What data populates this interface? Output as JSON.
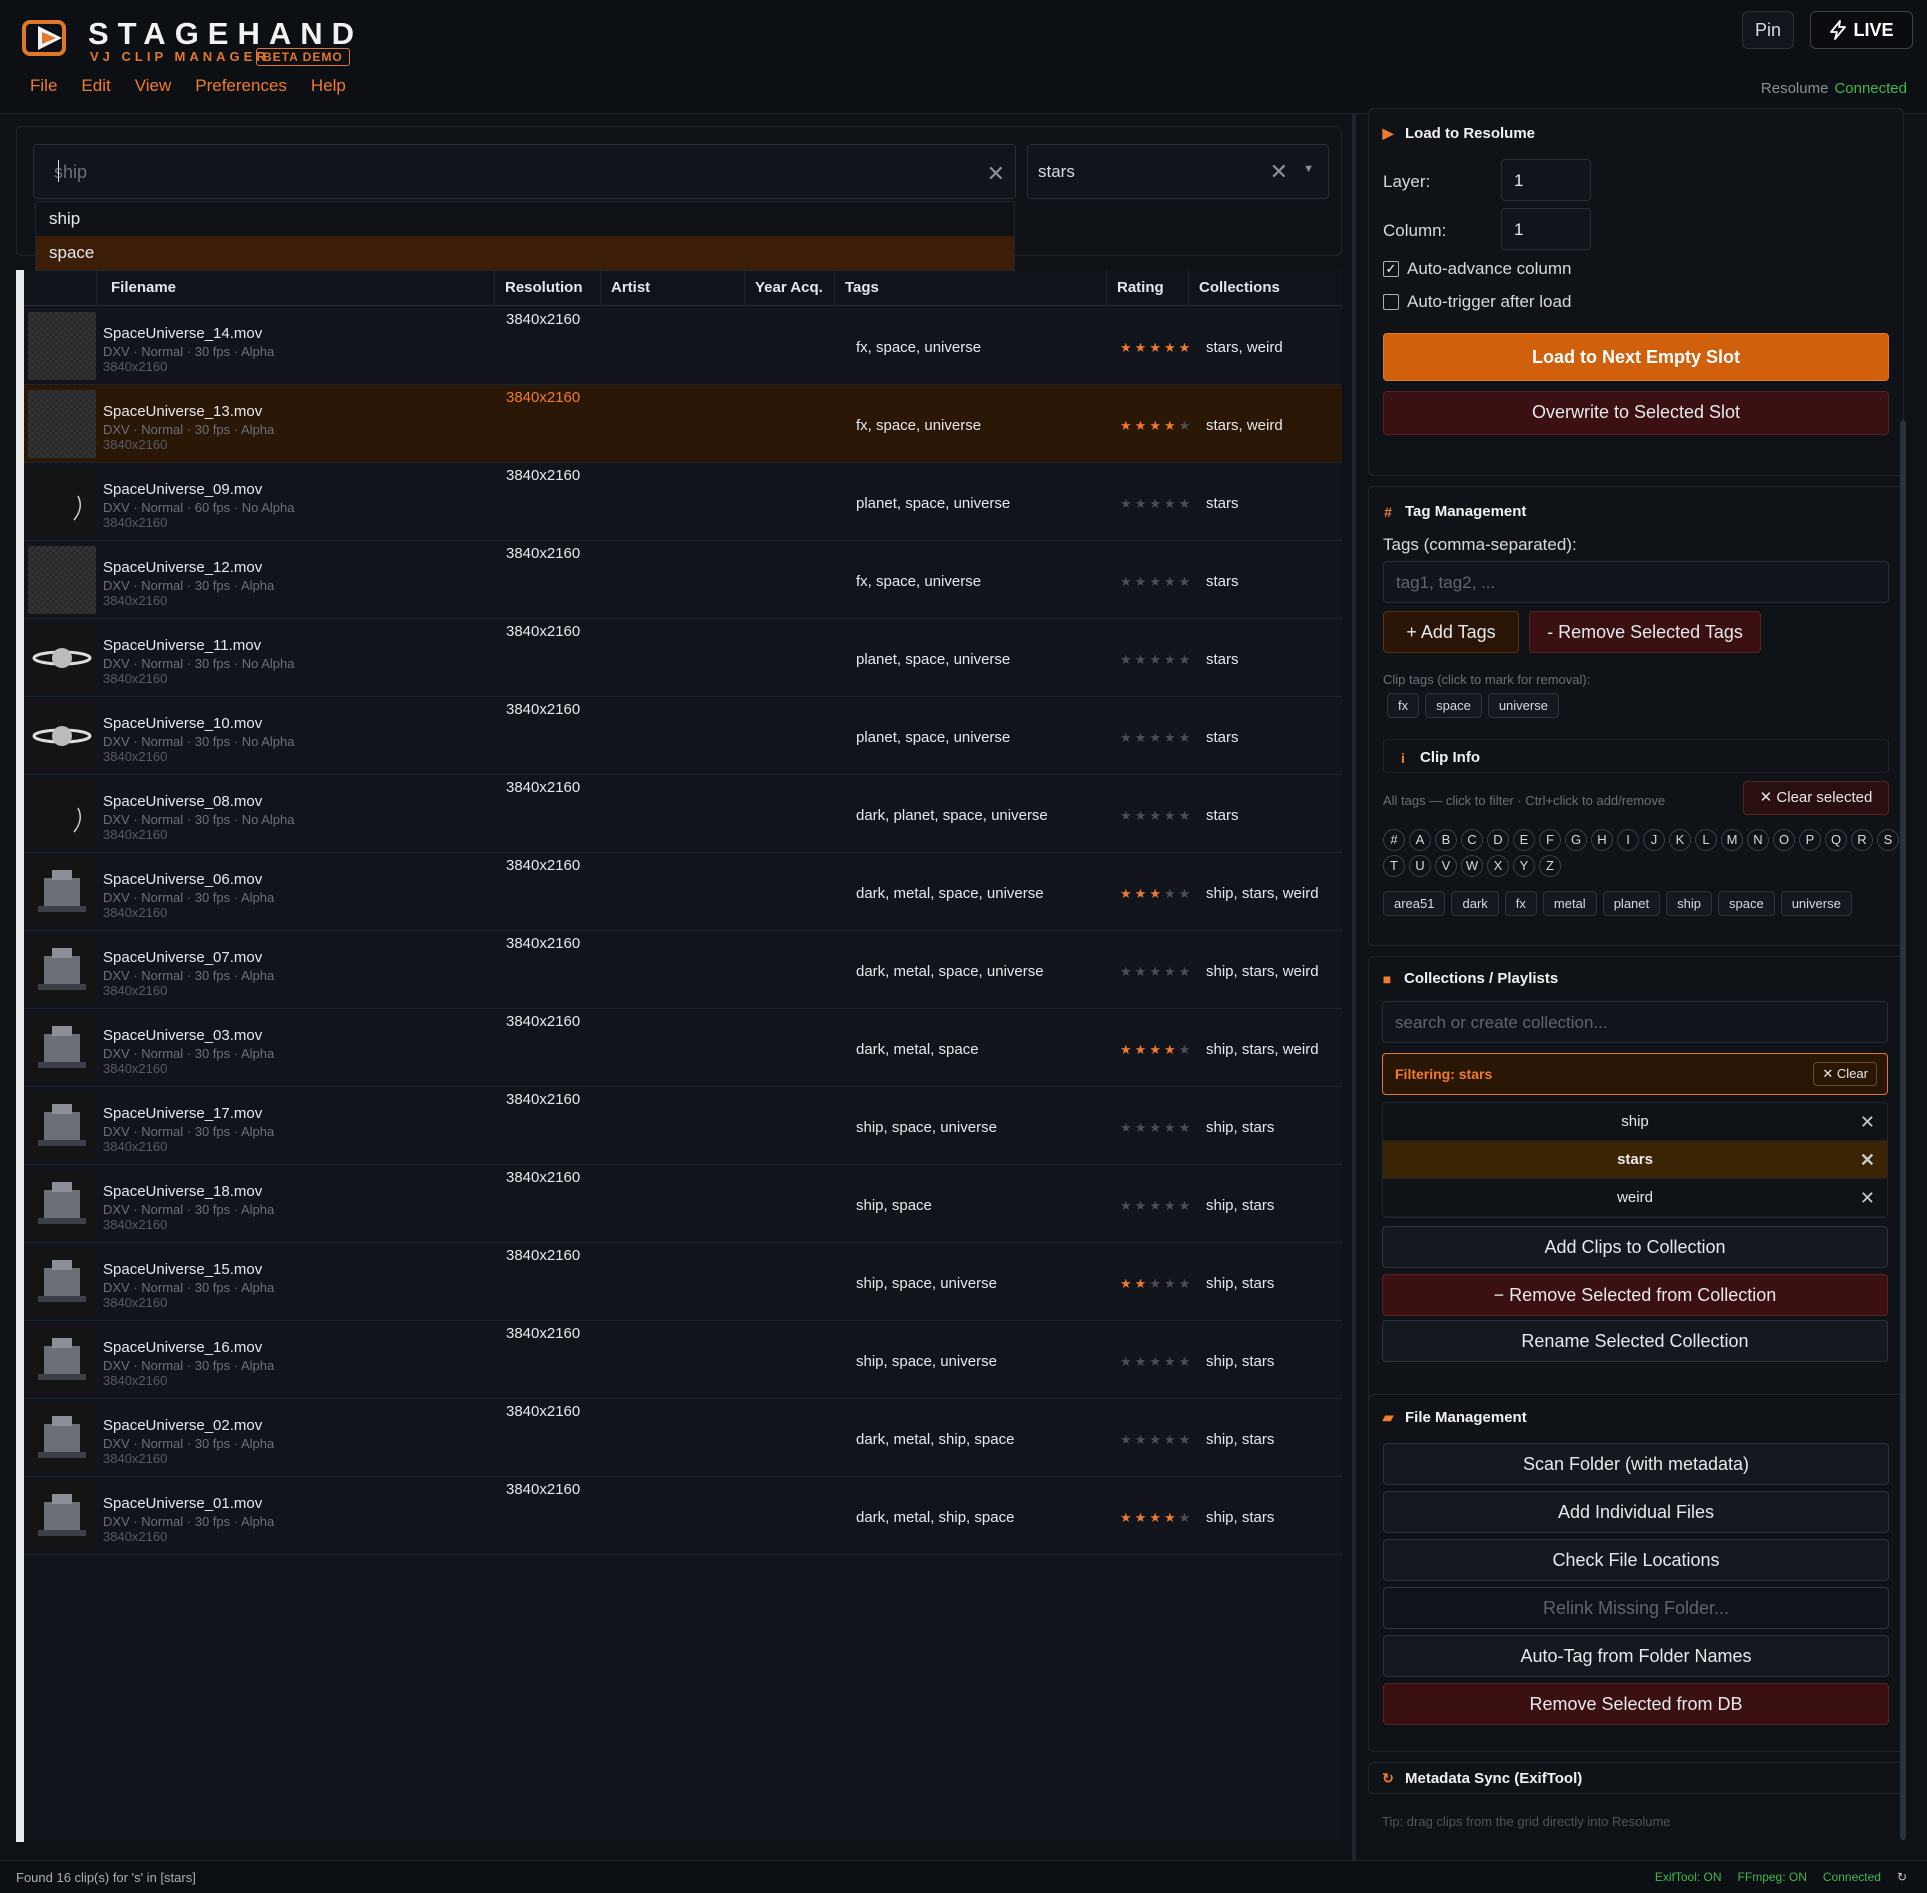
{
  "app": {
    "brand": "STAGEHAND",
    "subtitle": "VJ CLIP MANAGER",
    "beta": "BETA DEMO",
    "menu": [
      "File",
      "Edit",
      "View",
      "Preferences",
      "Help"
    ],
    "pin": "Pin",
    "live": "LIVE",
    "resolume_label": "Resolume",
    "resolume_state": "Connected"
  },
  "search": {
    "value": "ship",
    "suggestions": [
      "ship",
      "space"
    ],
    "collection": "stars"
  },
  "table": {
    "columns": [
      "Filename",
      "Resolution",
      "Artist",
      "Year Acq.",
      "Tags",
      "Rating",
      "Collections"
    ],
    "rows": [
      {
        "file": "SpaceUniverse_14.mov",
        "meta": "DXV · Normal · 30 fps · Alpha",
        "dim": "3840x2160",
        "res": "3840x2160",
        "tags": "fx, space, universe",
        "rating": 5,
        "colls": "stars, weird",
        "thumb": "checker"
      },
      {
        "file": "SpaceUniverse_13.mov",
        "meta": "DXV · Normal · 30 fps · Alpha",
        "dim": "3840x2160",
        "res": "3840x2160",
        "tags": "fx, space, universe",
        "rating": 4,
        "colls": "stars, weird",
        "thumb": "checker",
        "selected": true
      },
      {
        "file": "SpaceUniverse_09.mov",
        "meta": "DXV · Normal · 60 fps · No Alpha",
        "dim": "3840x2160",
        "res": "3840x2160",
        "tags": "planet, space, universe",
        "rating": 0,
        "colls": "stars",
        "thumb": "dark"
      },
      {
        "file": "SpaceUniverse_12.mov",
        "meta": "DXV · Normal · 30 fps · Alpha",
        "dim": "3840x2160",
        "res": "3840x2160",
        "tags": "fx, space, universe",
        "rating": 0,
        "colls": "stars",
        "thumb": "checker"
      },
      {
        "file": "SpaceUniverse_11.mov",
        "meta": "DXV · Normal · 30 fps · No Alpha",
        "dim": "3840x2160",
        "res": "3840x2160",
        "tags": "planet, space, universe",
        "rating": 0,
        "colls": "stars",
        "thumb": "planet"
      },
      {
        "file": "SpaceUniverse_10.mov",
        "meta": "DXV · Normal · 30 fps · No Alpha",
        "dim": "3840x2160",
        "res": "3840x2160",
        "tags": "planet, space, universe",
        "rating": 0,
        "colls": "stars",
        "thumb": "planet"
      },
      {
        "file": "SpaceUniverse_08.mov",
        "meta": "DXV · Normal · 30 fps · No Alpha",
        "dim": "3840x2160",
        "res": "3840x2160",
        "tags": "dark, planet, space, universe",
        "rating": 0,
        "colls": "stars",
        "thumb": "dark"
      },
      {
        "file": "SpaceUniverse_06.mov",
        "meta": "DXV · Normal · 30 fps · Alpha",
        "dim": "3840x2160",
        "res": "3840x2160",
        "tags": "dark, metal, space, universe",
        "rating": 3,
        "colls": "ship, stars, weird",
        "thumb": "ship"
      },
      {
        "file": "SpaceUniverse_07.mov",
        "meta": "DXV · Normal · 30 fps · Alpha",
        "dim": "3840x2160",
        "res": "3840x2160",
        "tags": "dark, metal, space, universe",
        "rating": 0,
        "colls": "ship, stars, weird",
        "thumb": "ship"
      },
      {
        "file": "SpaceUniverse_03.mov",
        "meta": "DXV · Normal · 30 fps · Alpha",
        "dim": "3840x2160",
        "res": "3840x2160",
        "tags": "dark, metal, space",
        "rating": 4,
        "colls": "ship, stars, weird",
        "thumb": "ship"
      },
      {
        "file": "SpaceUniverse_17.mov",
        "meta": "DXV · Normal · 30 fps · Alpha",
        "dim": "3840x2160",
        "res": "3840x2160",
        "tags": "ship, space, universe",
        "rating": 0,
        "colls": "ship, stars",
        "thumb": "ship"
      },
      {
        "file": "SpaceUniverse_18.mov",
        "meta": "DXV · Normal · 30 fps · Alpha",
        "dim": "3840x2160",
        "res": "3840x2160",
        "tags": "ship, space",
        "rating": 0,
        "colls": "ship, stars",
        "thumb": "ship"
      },
      {
        "file": "SpaceUniverse_15.mov",
        "meta": "DXV · Normal · 30 fps · Alpha",
        "dim": "3840x2160",
        "res": "3840x2160",
        "tags": "ship, space, universe",
        "rating": 2,
        "colls": "ship, stars",
        "thumb": "ship"
      },
      {
        "file": "SpaceUniverse_16.mov",
        "meta": "DXV · Normal · 30 fps · Alpha",
        "dim": "3840x2160",
        "res": "3840x2160",
        "tags": "ship, space, universe",
        "rating": 0,
        "colls": "ship, stars",
        "thumb": "ship"
      },
      {
        "file": "SpaceUniverse_02.mov",
        "meta": "DXV · Normal · 30 fps · Alpha",
        "dim": "3840x2160",
        "res": "3840x2160",
        "tags": "dark, metal, ship, space",
        "rating": 0,
        "colls": "ship, stars",
        "thumb": "ship"
      },
      {
        "file": "SpaceUniverse_01.mov",
        "meta": "DXV · Normal · 30 fps · Alpha",
        "dim": "3840x2160",
        "res": "3840x2160",
        "tags": "dark, metal, ship, space",
        "rating": 4,
        "colls": "ship, stars",
        "thumb": "ship"
      }
    ]
  },
  "load": {
    "title": "Load to Resolume",
    "layer_label": "Layer:",
    "layer": "1",
    "column_label": "Column:",
    "column": "1",
    "auto_advance": "Auto-advance column",
    "auto_trigger": "Auto-trigger after load",
    "load_next": "Load to Next Empty Slot",
    "overwrite": "Overwrite to Selected Slot"
  },
  "tagmgmt": {
    "title": "Tag Management",
    "tags_label": "Tags (comma-separated):",
    "tags_placeholder": "tag1, tag2, ...",
    "add": "+ Add Tags",
    "remove": "- Remove Selected Tags",
    "clip_hint": "Clip tags (click to mark for removal):",
    "clip_tags": [
      "fx",
      "space",
      "universe"
    ]
  },
  "clipinfo": {
    "title": "Clip Info",
    "hint": "All tags — click to filter · Ctrl+click to add/remove",
    "clear": "Clear selected",
    "letters": [
      "#",
      "A",
      "B",
      "C",
      "D",
      "E",
      "F",
      "G",
      "H",
      "I",
      "J",
      "K",
      "L",
      "M",
      "N",
      "O",
      "P",
      "Q",
      "R",
      "S",
      "T",
      "U",
      "V",
      "W",
      "X",
      "Y",
      "Z"
    ],
    "all_tags": [
      "area51",
      "dark",
      "fx",
      "metal",
      "planet",
      "ship",
      "space",
      "universe"
    ]
  },
  "collections": {
    "title": "Collections / Playlists",
    "placeholder": "search or create collection...",
    "filtering": "Filtering: stars",
    "clear": "Clear",
    "items": [
      {
        "name": "ship"
      },
      {
        "name": "stars",
        "active": true
      },
      {
        "name": "weird"
      }
    ],
    "add": "Add Clips to Collection",
    "remove": "− Remove Selected from Collection",
    "rename": "Rename Selected Collection"
  },
  "files": {
    "title": "File Management",
    "scan": "Scan Folder (with metadata)",
    "add": "Add Individual Files",
    "check": "Check File Locations",
    "relink": "Relink Missing Folder...",
    "autotag": "Auto-Tag from Folder Names",
    "removedb": "Remove Selected from DB"
  },
  "metasync": {
    "title": "Metadata Sync (ExifTool)",
    "tip": "Tip: drag clips from the grid directly into Resolume"
  },
  "status": {
    "found": "Found 16 clip(s) for 's' in [stars]",
    "exif": "ExifTool: ON",
    "ffmpeg": "FFmpeg: ON",
    "conn": "Connected",
    "refresh": "↻"
  },
  "colors": {
    "accent": "#f07b2a",
    "ok": "#3fb950",
    "danger": "#3a1012"
  }
}
